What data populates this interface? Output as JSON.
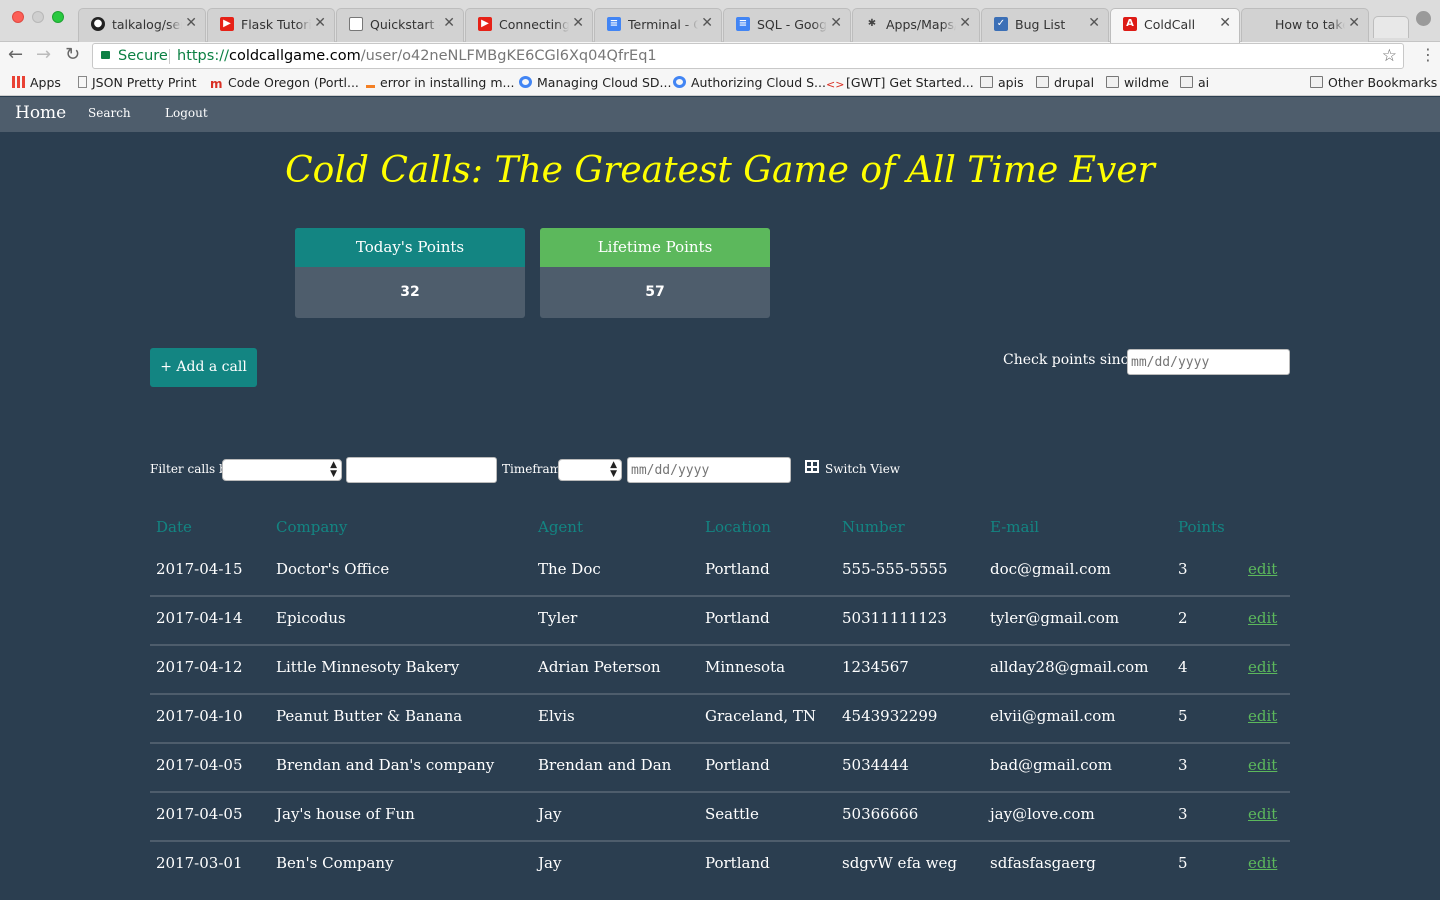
{
  "browser": {
    "tabs": [
      {
        "label": "talkalog/serv",
        "icon": "github-icon"
      },
      {
        "label": "Flask Tutorial",
        "icon": "youtube-icon"
      },
      {
        "label": "Quickstart —",
        "icon": "document-icon"
      },
      {
        "label": "Connecting to",
        "icon": "youtube-icon"
      },
      {
        "label": "Terminal - Go",
        "icon": "google-docs-icon"
      },
      {
        "label": "SQL - Google",
        "icon": "google-docs-icon"
      },
      {
        "label": "Apps/Maps/R",
        "icon": "app-icon"
      },
      {
        "label": "Bug List",
        "icon": "bug-icon"
      },
      {
        "label": "ColdCall",
        "icon": "angular-icon"
      },
      {
        "label": "How to take a",
        "icon": "apple-icon"
      }
    ],
    "secure_label": "Secure",
    "url_scheme": "https://",
    "url_host": "coldcallgame.com",
    "url_path": "/user/o42neNLFMBgKE6CGl6Xq04QfrEq1",
    "bookmarks": [
      {
        "label": "Apps"
      },
      {
        "label": "JSON Pretty Print"
      },
      {
        "label": "Code Oregon (Portl..."
      },
      {
        "label": "error in installing m..."
      },
      {
        "label": "Managing Cloud SD..."
      },
      {
        "label": "Authorizing Cloud S..."
      },
      {
        "label": "[GWT] Get Started..."
      },
      {
        "label": "apis"
      },
      {
        "label": "drupal"
      },
      {
        "label": "wildme"
      },
      {
        "label": "ai"
      }
    ],
    "other_bookmarks": "Other Bookmarks"
  },
  "nav": {
    "home": "Home",
    "search": "Search",
    "logout": "Logout"
  },
  "page": {
    "title": "Cold Calls: The Greatest Game of All Time Ever",
    "todays_points": {
      "label": "Today's Points",
      "value": "32",
      "color": "#138582"
    },
    "lifetime_points": {
      "label": "Lifetime Points",
      "value": "57",
      "color": "#5cb85c"
    },
    "add_call": "+ Add a call",
    "check_points_label": "Check points since:",
    "check_points_placeholder": "mm/dd/yyyy",
    "filter_label": "Filter calls by:",
    "timeframe_label": "Timeframe",
    "timeframe_date_placeholder": "mm/dd/yyyy",
    "switch_view": "Switch View"
  },
  "table": {
    "headers": [
      "Date",
      "Company",
      "Agent",
      "Location",
      "Number",
      "E-mail",
      "Points"
    ],
    "edit_label": "edit",
    "rows": [
      [
        "2017-04-15",
        "Doctor's Office",
        "The Doc",
        "Portland",
        "555-555-5555",
        "doc@gmail.com",
        "3"
      ],
      [
        "2017-04-14",
        "Epicodus",
        "Tyler",
        "Portland",
        "50311111123",
        "tyler@gmail.com",
        "2"
      ],
      [
        "2017-04-12",
        "Little Minnesoty Bakery",
        "Adrian Peterson",
        "Minnesota",
        "1234567",
        "allday28@gmail.com",
        "4"
      ],
      [
        "2017-04-10",
        "Peanut Butter & Banana",
        "Elvis",
        "Graceland, TN",
        "4543932299",
        "elvii@gmail.com",
        "5"
      ],
      [
        "2017-04-05",
        "Brendan and Dan's company",
        "Brendan and Dan",
        "Portland",
        "5034444",
        "bad@gmail.com",
        "3"
      ],
      [
        "2017-04-05",
        "Jay's house of Fun",
        "Jay",
        "Seattle",
        "50366666",
        "jay@love.com",
        "3"
      ],
      [
        "2017-03-01",
        "Ben's Company",
        "Jay",
        "Portland",
        "sdgvW efa weg",
        "sdfasfasgaerg",
        "5"
      ]
    ]
  }
}
